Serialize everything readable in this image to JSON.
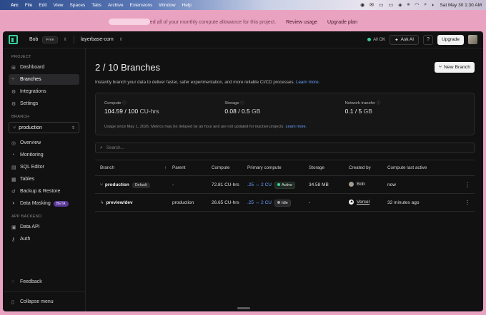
{
  "menubar": {
    "app": "Arc",
    "items": [
      "File",
      "Edit",
      "View",
      "Spaces",
      "Tabs",
      "Archive",
      "Extensions",
      "Window",
      "Help"
    ],
    "clock": "Sat May 30   1:30 AM"
  },
  "banner": {
    "message": "You've used all of your monthly compute allowance for this project.",
    "review": "Review usage",
    "upgrade": "Upgrade plan"
  },
  "topbar": {
    "org": "Bob",
    "plan": "Free",
    "project": "layerbase-com",
    "status": "All OK",
    "ask_ai": "Ask AI",
    "help_icon": "?",
    "upgrade": "Upgrade"
  },
  "sidebar": {
    "project_label": "PROJECT",
    "project_items": [
      {
        "label": "Dashboard",
        "icon": "dashboard-icon",
        "glyph": "⊞"
      },
      {
        "label": "Branches",
        "icon": "branch-icon",
        "glyph": "⑂"
      },
      {
        "label": "Integrations",
        "icon": "integrations-icon",
        "glyph": "⚙"
      },
      {
        "label": "Settings",
        "icon": "gear-icon",
        "glyph": "⚙"
      }
    ],
    "branch_label": "BRANCH",
    "branch_selected": "production",
    "branch_items": [
      {
        "label": "Overview",
        "icon": "overview-icon",
        "glyph": "◎"
      },
      {
        "label": "Monitoring",
        "icon": "monitoring-icon",
        "glyph": "◔"
      },
      {
        "label": "SQL Editor",
        "icon": "sql-icon",
        "glyph": "▤"
      },
      {
        "label": "Tables",
        "icon": "table-icon",
        "glyph": "▦"
      },
      {
        "label": "Backup & Restore",
        "icon": "backup-icon",
        "glyph": "↺"
      },
      {
        "label": "Data Masking",
        "icon": "mask-icon",
        "glyph": "◑"
      }
    ],
    "beta": "BETA",
    "backend_label": "APP BACKEND",
    "backend_items": [
      {
        "label": "Data API",
        "icon": "api-icon",
        "glyph": "▣"
      },
      {
        "label": "Auth",
        "icon": "auth-icon",
        "glyph": "⚷"
      }
    ],
    "feedback": "Feedback",
    "collapse": "Collapse menu"
  },
  "main": {
    "title": "2 / 10 Branches",
    "new_branch": "New Branch",
    "subtitle": "Instantly branch your data to deliver faster, safer experimentation, and more reliable CI/CD processes.",
    "learn_more": "Learn more.",
    "usage": {
      "compute_label": "Compute",
      "compute_value": "104.59 / 100",
      "compute_unit": "CU-hrs",
      "storage_label": "Storage",
      "storage_value": "0.08 / 0.5",
      "storage_unit": "GB",
      "transfer_label": "Network transfer",
      "transfer_value": "0.1 / 5",
      "transfer_unit": "GB",
      "note": "Usage since May 1, 2026. Metrics may be delayed by an hour and are not updated for inactive projects.",
      "note_link": "Learn more."
    },
    "search_placeholder": "Search...",
    "columns": [
      "Branch",
      "Parent",
      "Compute",
      "Primary compute",
      "Storage",
      "Created by",
      "Compute last active"
    ],
    "rows": [
      {
        "branch": "production",
        "badge": "Default",
        "parent": "-",
        "compute": "72.81 CU-hrs",
        "cu": ".25 ↔ 2 CU",
        "status": "Active",
        "storage": "34.58 MB",
        "created_by": "Bob",
        "last_active": "now"
      },
      {
        "branch": "preview/dev",
        "badge": "",
        "parent": "production",
        "compute": "26.65 CU-hrs",
        "cu": ".25 ↔ 2 CU",
        "status": "Idle",
        "storage": "-",
        "created_by": "Vercel",
        "last_active": "32 minutes ago"
      }
    ]
  }
}
